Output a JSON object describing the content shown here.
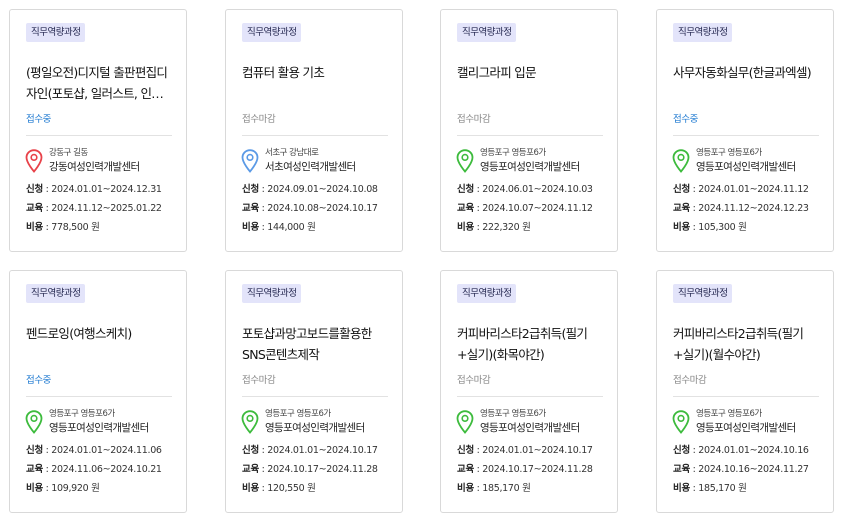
{
  "cards": [
    {
      "badge": "직무역량과정",
      "title": "(평일오전)디지털 출판편집디자인(포토샵, 일러스트, 인디자…",
      "status": "접수중",
      "addr": "강동구 길동",
      "center": "강동여성인력개발센터",
      "pin_color": "#e8424a",
      "apply_label": "신청",
      "apply": " : 2024.01.01~2024.12.31",
      "edu_label": "교육",
      "edu": " : 2024.11.12~2025.01.22",
      "cost_label": "비용",
      "cost": " : 778,500 원"
    },
    {
      "badge": "직무역량과정",
      "title": "컴퓨터 활용 기초",
      "status": "접수마감",
      "addr": "서초구 강남대로",
      "center": "서초여성인력개발센터",
      "pin_color": "#5b9ae6",
      "apply_label": "신청",
      "apply": " : 2024.09.01~2024.10.08",
      "edu_label": "교육",
      "edu": " : 2024.10.08~2024.10.17",
      "cost_label": "비용",
      "cost": " : 144,000 원"
    },
    {
      "badge": "직무역량과정",
      "title": "캘리그라피 입문",
      "status": "접수마감",
      "addr": "영등포구 영등포6가",
      "center": "영등포여성인력개발센터",
      "pin_color": "#3dbb3d",
      "apply_label": "신청",
      "apply": " : 2024.06.01~2024.10.03",
      "edu_label": "교육",
      "edu": " : 2024.10.07~2024.11.12",
      "cost_label": "비용",
      "cost": " : 222,320 원"
    },
    {
      "badge": "직무역량과정",
      "title": "사무자동화실무(한글과엑셀)",
      "status": "접수중",
      "addr": "영등포구 영등포6가",
      "center": "영등포여성인력개발센터",
      "pin_color": "#3dbb3d",
      "apply_label": "신청",
      "apply": " : 2024.01.01~2024.11.12",
      "edu_label": "교육",
      "edu": " : 2024.11.12~2024.12.23",
      "cost_label": "비용",
      "cost": " : 105,300 원"
    },
    {
      "badge": "직무역량과정",
      "title": "펜드로잉(여행스케치)",
      "status": "접수중",
      "addr": "영등포구 영등포6가",
      "center": "영등포여성인력개발센터",
      "pin_color": "#3dbb3d",
      "apply_label": "신청",
      "apply": " : 2024.01.01~2024.11.06",
      "edu_label": "교육",
      "edu": " : 2024.11.06~2024.10.21",
      "cost_label": "비용",
      "cost": " : 109,920 원"
    },
    {
      "badge": "직무역량과정",
      "title": "포토샵과망고보드를활용한SNS콘텐츠제작",
      "status": "접수마감",
      "addr": "영등포구 영등포6가",
      "center": "영등포여성인력개발센터",
      "pin_color": "#3dbb3d",
      "apply_label": "신청",
      "apply": " : 2024.01.01~2024.10.17",
      "edu_label": "교육",
      "edu": " : 2024.10.17~2024.11.28",
      "cost_label": "비용",
      "cost": " : 120,550 원"
    },
    {
      "badge": "직무역량과정",
      "title": "커피바리스타2급취득(필기+실기)(화목야간)",
      "status": "접수마감",
      "addr": "영등포구 영등포6가",
      "center": "영등포여성인력개발센터",
      "pin_color": "#3dbb3d",
      "apply_label": "신청",
      "apply": " : 2024.01.01~2024.10.17",
      "edu_label": "교육",
      "edu": " : 2024.10.17~2024.11.28",
      "cost_label": "비용",
      "cost": " : 185,170 원"
    },
    {
      "badge": "직무역량과정",
      "title": "커피바리스타2급취득(필기+실기)(월수야간)",
      "status": "접수마감",
      "addr": "영등포구 영등포6가",
      "center": "영등포여성인력개발센터",
      "pin_color": "#3dbb3d",
      "apply_label": "신청",
      "apply": " : 2024.01.01~2024.10.16",
      "edu_label": "교육",
      "edu": " : 2024.10.16~2024.11.27",
      "cost_label": "비용",
      "cost": " : 185,170 원"
    }
  ]
}
